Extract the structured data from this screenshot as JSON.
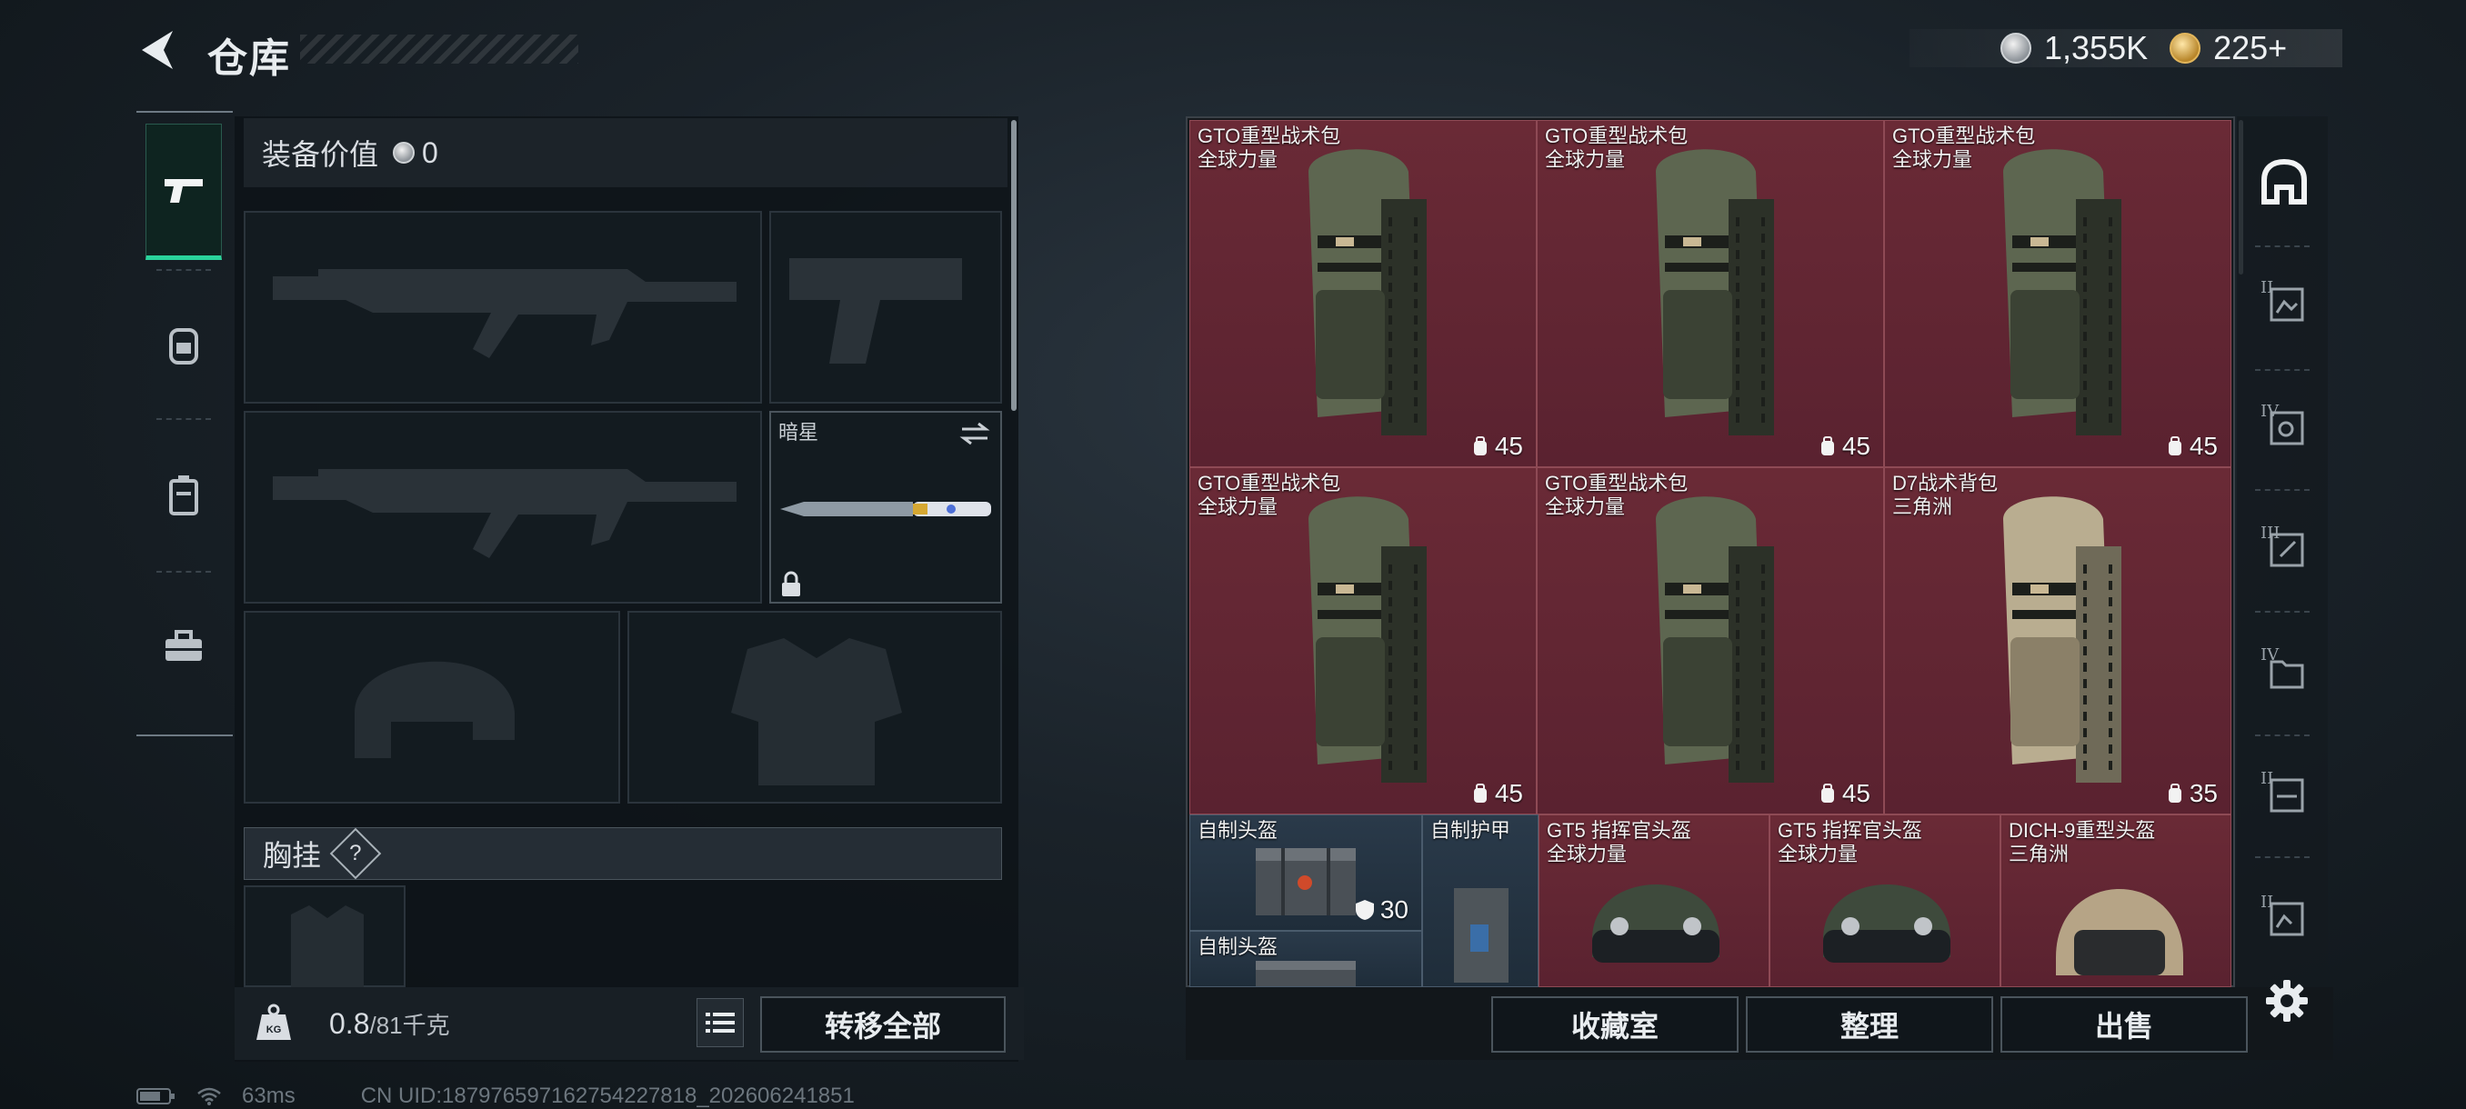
{
  "header": {
    "title": "仓库",
    "currency": [
      {
        "icon": "silver-coin-icon",
        "value": "1,355K"
      },
      {
        "icon": "gold-coin-icon",
        "value": "225+"
      }
    ]
  },
  "equipment": {
    "value_label": "装备价值",
    "value": "0",
    "melee_slot_label": "暗星",
    "chest_rig_label": "胸挂",
    "help_glyph": "?"
  },
  "footer_left": {
    "weight_current": "0.8",
    "weight_max": "/81千克",
    "weight_icon_text": "KG",
    "transfer_all": "转移全部"
  },
  "inventory": {
    "items": [
      {
        "name": "GTO重型战术包",
        "sub": "全球力量",
        "count": "45",
        "tone": "green"
      },
      {
        "name": "GTO重型战术包",
        "sub": "全球力量",
        "count": "45",
        "tone": "green"
      },
      {
        "name": "GTO重型战术包",
        "sub": "全球力量",
        "count": "45",
        "tone": "green"
      },
      {
        "name": "GTO重型战术包",
        "sub": "全球力量",
        "count": "45",
        "tone": "green"
      },
      {
        "name": "GTO重型战术包",
        "sub": "全球力量",
        "count": "45",
        "tone": "green"
      },
      {
        "name": "D7战术背包",
        "sub": "三角洲",
        "count": "35",
        "tone": "tan"
      }
    ],
    "bottom_items": [
      {
        "name": "自制头盔",
        "count": "30"
      },
      {
        "name": "自制头盔"
      },
      {
        "name": "自制护甲"
      },
      {
        "name": "GT5 指挥官头盔",
        "sub": "全球力量"
      },
      {
        "name": "GT5 指挥官头盔",
        "sub": "全球力量"
      },
      {
        "name": "DICH-9重型头盔",
        "sub": "三角洲"
      }
    ]
  },
  "footer_right": {
    "collection": "收藏室",
    "sort": "整理",
    "sell": "出售"
  },
  "side_icons": {
    "romans": [
      "II",
      "IV",
      "III",
      "IV",
      "II",
      "II"
    ]
  },
  "status_bar": {
    "ping": "63ms",
    "uid": "CN UID:18797659716275422781​8_202606241851"
  },
  "colors": {
    "accent": "#2ad39b",
    "cell_red": "#5a2230",
    "panel": "#15191d"
  }
}
